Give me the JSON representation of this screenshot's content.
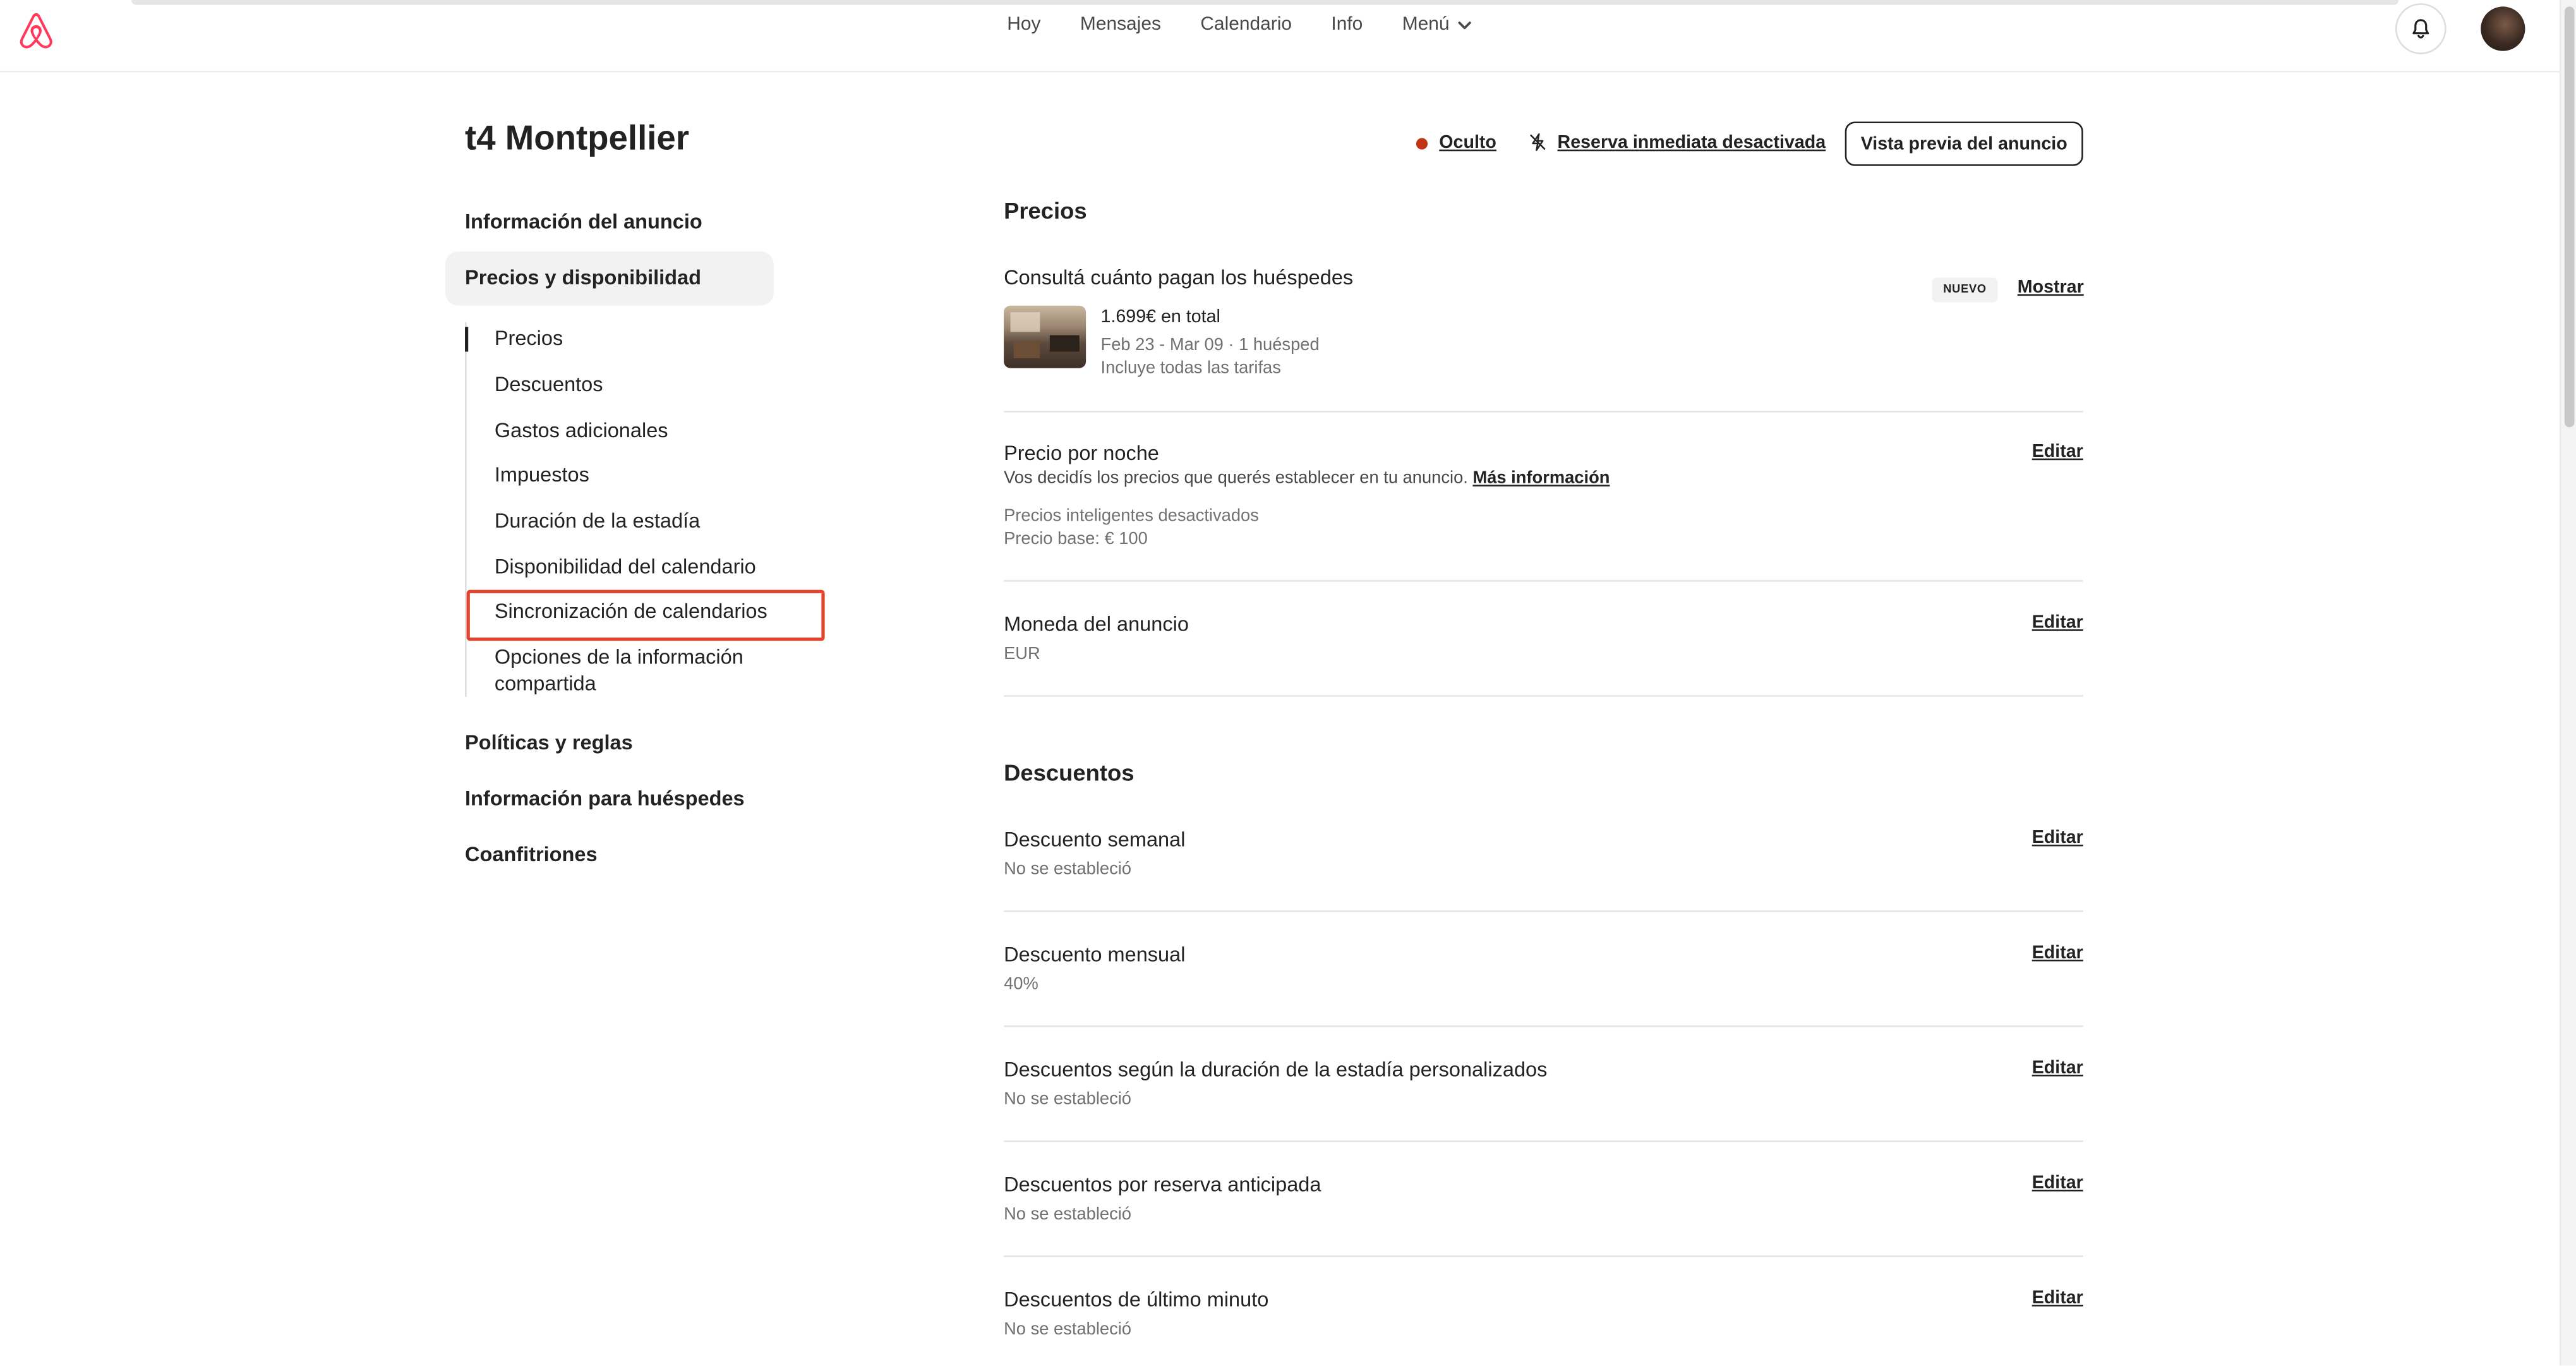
{
  "header": {
    "nav": [
      "Hoy",
      "Mensajes",
      "Calendario",
      "Info",
      "Menú"
    ]
  },
  "page": {
    "title": "t4 Montpellier"
  },
  "sidebar": {
    "main_items": [
      "Información del anuncio",
      "Precios y disponibilidad",
      "Políticas y reglas",
      "Información para huéspedes",
      "Coanfitriones"
    ],
    "sub_items": [
      "Precios",
      "Descuentos",
      "Gastos adicionales",
      "Impuestos",
      "Duración de la estadía",
      "Disponibilidad del calendario",
      "Sincronización de calendarios",
      "Opciones de la información",
      "compartida"
    ]
  },
  "status": {
    "hidden_label": "Oculto",
    "instant_label": "Reserva inmediata desactivada",
    "preview_label": "Vista previa del anuncio",
    "dot_color": "#c13515"
  },
  "pricing": {
    "section_title": "Precios",
    "guest_pay_title": "Consultá cuánto pagan los huéspedes",
    "badge": "NUEVO",
    "show_label": "Mostrar",
    "total": "1.699€ en total",
    "dates": "Feb 23 - Mar 09 · 1 huésped",
    "fees": "Incluye todas las tarifas",
    "nightly_title": "Precio por noche",
    "nightly_desc": "Vos decidís los precios que querés establecer en tu anuncio.",
    "more_info": "Más información",
    "smart_prices": "Precios inteligentes desactivados",
    "base_price": "Precio base: € 100",
    "currency_title": "Moneda del anuncio",
    "currency_value": "EUR",
    "edit_label": "Editar"
  },
  "discounts": {
    "section_title": "Descuentos",
    "rows": [
      {
        "title": "Descuento semanal",
        "value": "No se estableció"
      },
      {
        "title": "Descuento mensual",
        "value": "40%"
      },
      {
        "title": "Descuentos según la duración de la estadía personalizados",
        "value": "No se estableció"
      },
      {
        "title": "Descuentos por reserva anticipada",
        "value": "No se estableció"
      },
      {
        "title": "Descuentos de último minuto",
        "value": "No se estableció"
      }
    ]
  }
}
